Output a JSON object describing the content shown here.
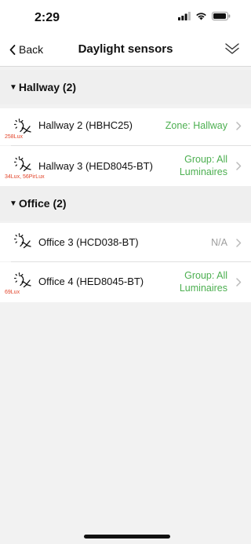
{
  "status_bar": {
    "time": "2:29"
  },
  "nav": {
    "back_label": "Back",
    "title": "Daylight sensors"
  },
  "sections": [
    {
      "title": "Hallway (2)",
      "rows": [
        {
          "name": "Hallway 2 (HBHC25)",
          "lux": "258Lux",
          "assignment": "Zone: Hallway"
        },
        {
          "name": "Hallway 3 (HED8045-BT)",
          "lux": "34Lux,  56PirLux",
          "assignment_line1": "Group: All",
          "assignment_line2": "Luminaires"
        }
      ]
    },
    {
      "title": "Office (2)",
      "rows": [
        {
          "name": "Office 3 (HCD038-BT)",
          "lux": "",
          "assignment": "N/A"
        },
        {
          "name": "Office 4 (HED8045-BT)",
          "lux": "69Lux",
          "assignment_line1": "Group: All",
          "assignment_line2": "Luminaires"
        }
      ]
    }
  ],
  "colors": {
    "assigned": "#4caf50",
    "unassigned": "#9e9e9e",
    "lux": "#e2452b"
  }
}
